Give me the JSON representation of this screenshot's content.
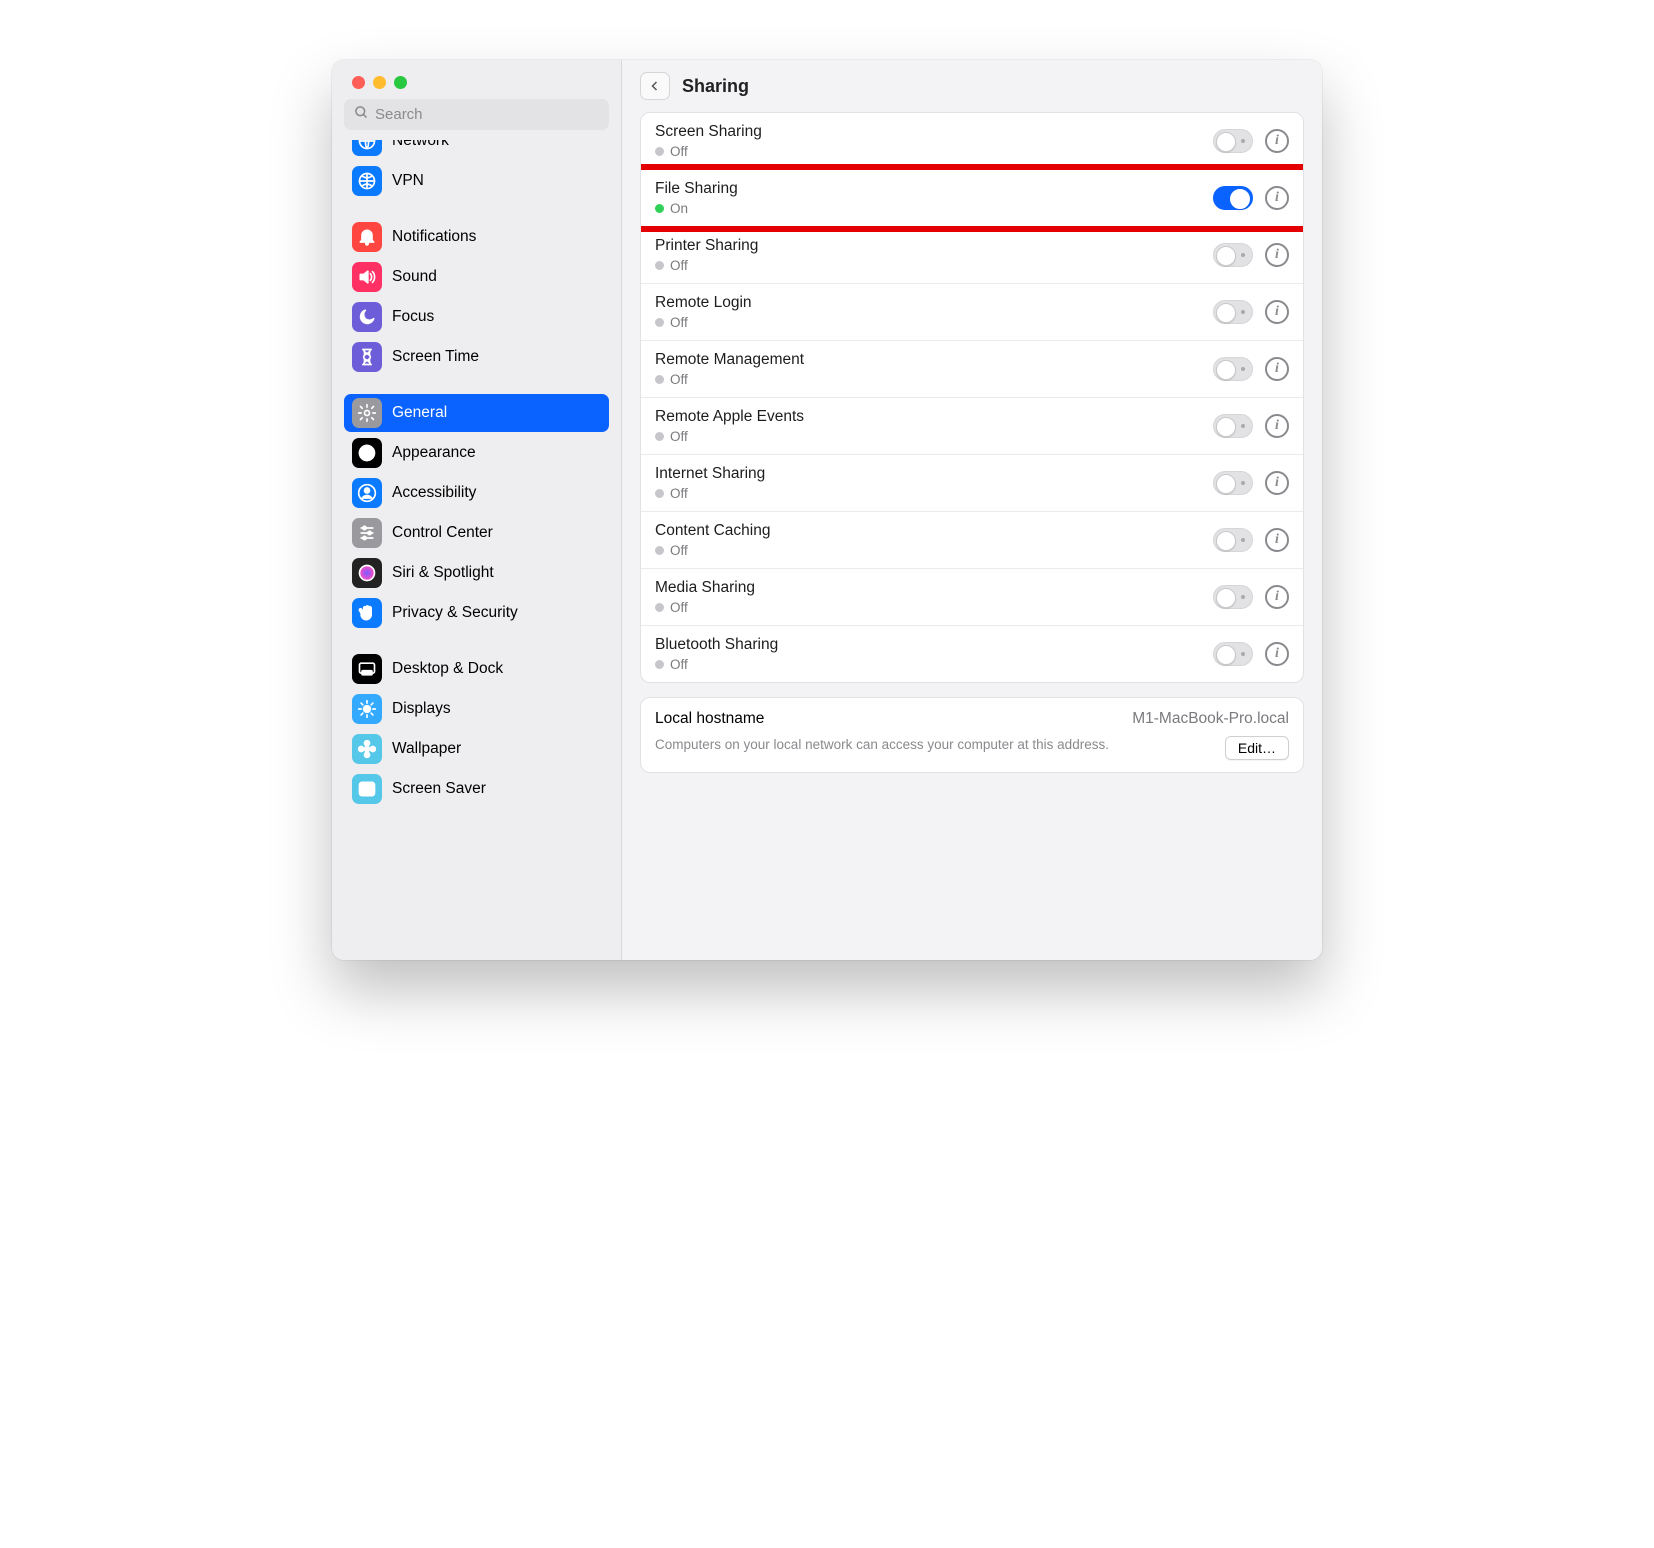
{
  "search": {
    "placeholder": "Search"
  },
  "sidebar": {
    "items": [
      {
        "label": "Network",
        "icon": "globe",
        "bg": "#0a7aff",
        "fg": "#fff",
        "half": true
      },
      {
        "label": "VPN",
        "icon": "globe-grid",
        "bg": "#0a7aff",
        "fg": "#fff"
      },
      {
        "label": "Notifications",
        "icon": "bell",
        "bg": "#ff4640",
        "fg": "#fff"
      },
      {
        "label": "Sound",
        "icon": "speaker",
        "bg": "#ff3063",
        "fg": "#fff"
      },
      {
        "label": "Focus",
        "icon": "moon",
        "bg": "#6e5dd8",
        "fg": "#fff"
      },
      {
        "label": "Screen Time",
        "icon": "hourglass",
        "bg": "#6e5dd8",
        "fg": "#fff"
      },
      {
        "label": "General",
        "icon": "gear",
        "bg": "#9a9a9e",
        "fg": "#fff",
        "selected": true
      },
      {
        "label": "Appearance",
        "icon": "contrast",
        "bg": "#000",
        "fg": "#fff"
      },
      {
        "label": "Accessibility",
        "icon": "person",
        "bg": "#0a7aff",
        "fg": "#fff"
      },
      {
        "label": "Control Center",
        "icon": "sliders",
        "bg": "#9a9a9e",
        "fg": "#fff"
      },
      {
        "label": "Siri & Spotlight",
        "icon": "siri",
        "bg": "#222",
        "fg": "#fff"
      },
      {
        "label": "Privacy & Security",
        "icon": "hand",
        "bg": "#0a7aff",
        "fg": "#fff"
      },
      {
        "label": "Desktop & Dock",
        "icon": "dock",
        "bg": "#000",
        "fg": "#fff"
      },
      {
        "label": "Displays",
        "icon": "sun",
        "bg": "#33aaff",
        "fg": "#fff"
      },
      {
        "label": "Wallpaper",
        "icon": "flower",
        "bg": "#55c7e8",
        "fg": "#fff"
      },
      {
        "label": "Screen Saver",
        "icon": "wave",
        "bg": "#55c7e8",
        "fg": "#fff"
      }
    ],
    "groupBreaks": [
      2,
      6,
      12
    ]
  },
  "header": {
    "title": "Sharing"
  },
  "services": [
    {
      "title": "Screen Sharing",
      "status": "Off",
      "on": false
    },
    {
      "title": "File Sharing",
      "status": "On",
      "on": true,
      "highlight": true
    },
    {
      "title": "Printer Sharing",
      "status": "Off",
      "on": false
    },
    {
      "title": "Remote Login",
      "status": "Off",
      "on": false
    },
    {
      "title": "Remote Management",
      "status": "Off",
      "on": false
    },
    {
      "title": "Remote Apple Events",
      "status": "Off",
      "on": false
    },
    {
      "title": "Internet Sharing",
      "status": "Off",
      "on": false
    },
    {
      "title": "Content Caching",
      "status": "Off",
      "on": false
    },
    {
      "title": "Media Sharing",
      "status": "Off",
      "on": false
    },
    {
      "title": "Bluetooth Sharing",
      "status": "Off",
      "on": false
    }
  ],
  "hostname": {
    "label": "Local hostname",
    "value": "M1-MacBook-Pro.local",
    "desc": "Computers on your local network can access your computer at this address.",
    "edit": "Edit…"
  }
}
